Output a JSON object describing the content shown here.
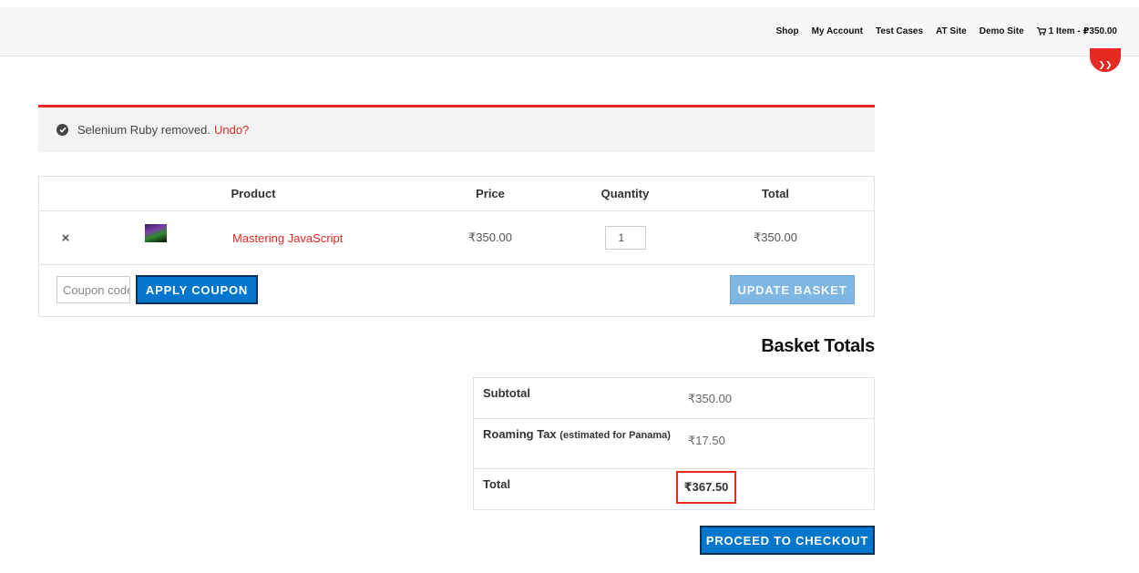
{
  "nav": {
    "items": [
      "Shop",
      "My Account",
      "Test Cases",
      "AT Site",
      "Demo Site"
    ],
    "cart_label": "1 Item - ₽350.00"
  },
  "notice": {
    "message": "Selenium Ruby removed.",
    "undo_label": "Undo?"
  },
  "cart": {
    "headers": {
      "product": "Product",
      "price": "Price",
      "quantity": "Quantity",
      "total": "Total"
    },
    "items": [
      {
        "remove": "×",
        "name": "Mastering JavaScript",
        "price": "₹350.00",
        "quantity": "1",
        "total": "₹350.00"
      }
    ],
    "coupon_placeholder": "Coupon code",
    "apply_coupon_label": "APPLY COUPON",
    "update_basket_label": "UPDATE BASKET"
  },
  "totals": {
    "title": "Basket Totals",
    "subtotal_label": "Subtotal",
    "subtotal_value": "₹350.00",
    "tax_label": "Roaming Tax",
    "tax_note": "(estimated for Panama)",
    "tax_value": "₹17.50",
    "total_label": "Total",
    "total_value": "₹367.50",
    "checkout_label": "PROCEED TO CHECKOUT"
  },
  "colors": {
    "accent": "#e42a22",
    "button_blue": "#0076cc"
  }
}
